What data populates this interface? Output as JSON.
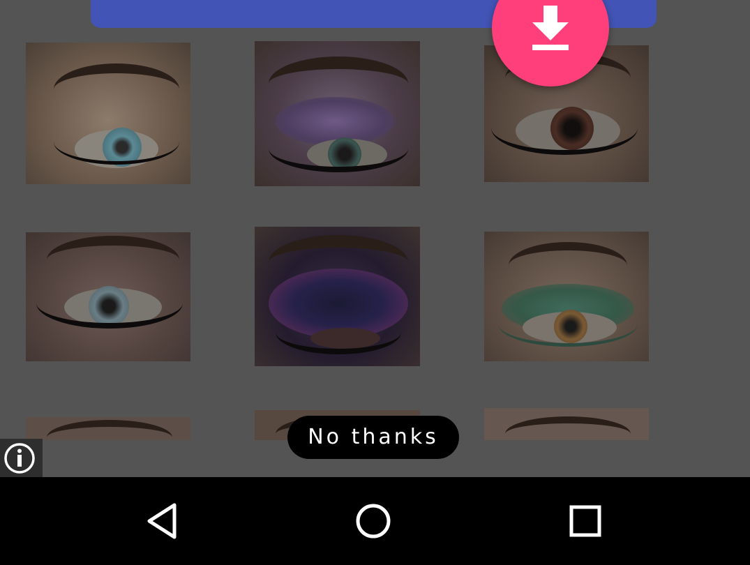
{
  "dialog": {
    "dismiss_label": "No thanks"
  },
  "icons": {
    "download": "download-arrow-icon",
    "info": "info-icon",
    "back": "back-triangle-icon",
    "home": "home-circle-icon",
    "recents": "recents-square-icon"
  },
  "gallery": {
    "items": [
      {
        "name": "makeup-photo-1"
      },
      {
        "name": "makeup-photo-2"
      },
      {
        "name": "makeup-photo-3"
      },
      {
        "name": "makeup-photo-4"
      },
      {
        "name": "makeup-photo-5"
      },
      {
        "name": "makeup-photo-6"
      },
      {
        "name": "makeup-photo-7"
      },
      {
        "name": "makeup-photo-8"
      },
      {
        "name": "makeup-photo-9"
      }
    ]
  },
  "colors": {
    "banner": "#4254b5",
    "fab": "#ff3f7c",
    "overlay": "#545454",
    "nav_bar": "#000000"
  }
}
